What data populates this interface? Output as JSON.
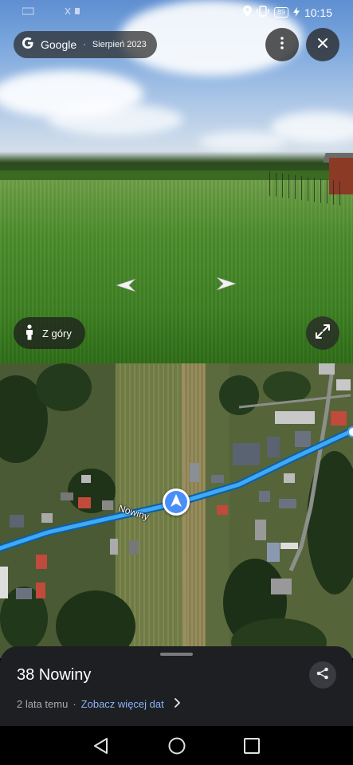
{
  "status_bar": {
    "time": "10:15",
    "battery": "89"
  },
  "street_view": {
    "provider": "Google",
    "capture_date": "Sierpień 2023",
    "view_mode_button": "Z góry"
  },
  "map": {
    "road_label": "Nowiny"
  },
  "place": {
    "title": "38 Nowiny",
    "age": "2 lata temu",
    "more_dates_link": "Zobacz więcej dat"
  },
  "colors": {
    "route_blue": "#3fa9f5",
    "location_marker": "#4a8ff7",
    "sheet_bg": "#1e1f23",
    "link": "#8ab4f8"
  },
  "icons": {
    "more": "more-vert-icon",
    "close": "close-icon",
    "pegman": "pegman-icon",
    "fullscreen": "fullscreen-icon",
    "share": "share-icon",
    "chevron": "chevron-right-icon",
    "nav_back": "back-icon",
    "nav_home": "home-icon",
    "nav_recents": "recents-icon"
  }
}
